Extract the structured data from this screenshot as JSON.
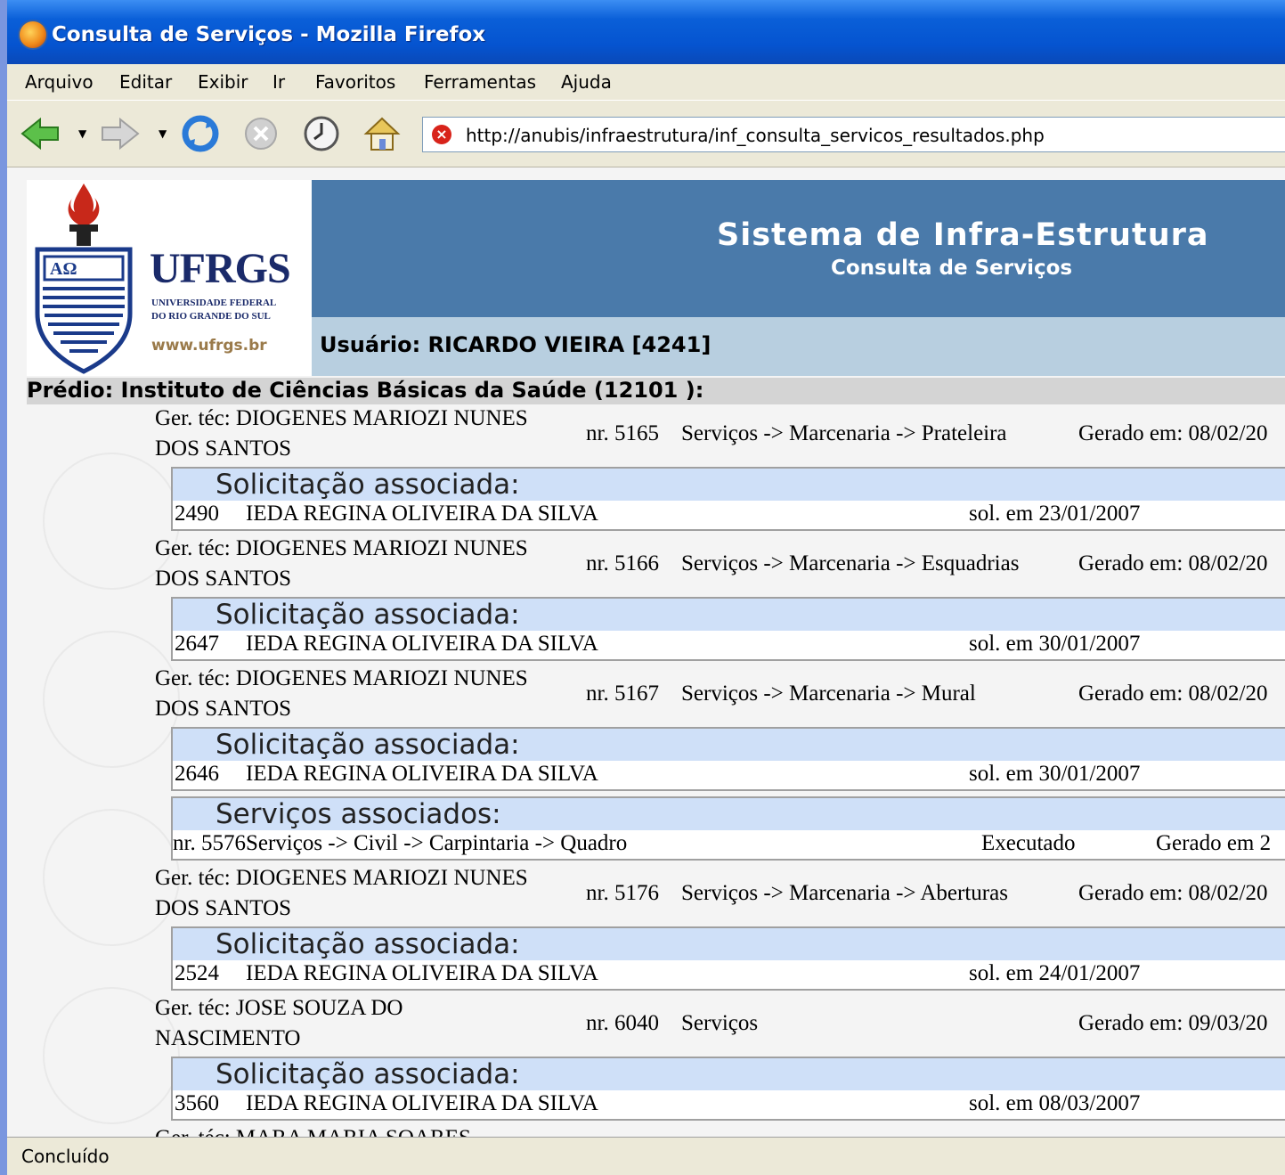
{
  "window": {
    "title": "Consulta de Serviços - Mozilla Firefox"
  },
  "menu": [
    "Arquivo",
    "Editar",
    "Exibir",
    "Ir",
    "Favoritos",
    "Ferramentas",
    "Ajuda"
  ],
  "toolbar": {
    "url": "http://anubis/infraestrutura/inf_consulta_servicos_resultados.php"
  },
  "logo": {
    "name": "UFRGS",
    "line1": "UNIVERSIDADE FEDERAL",
    "line2": "DO RIO GRANDE DO SUL",
    "site": "www.ufrgs.br"
  },
  "header": {
    "system": "Sistema de Infra-Estrutura",
    "subtitle": "Consulta de Serviços",
    "user": "Usuário: RICARDO VIEIRA [4241]"
  },
  "predio": "Prédio: Instituto de Ciências Básicas da Saúde (12101 ):",
  "labels": {
    "solicitacao": "Solicitação associada:",
    "servicos": "Serviços associados:"
  },
  "entries": [
    {
      "ger1": "Ger. téc: DIOGENES MARIOZI NUNES",
      "ger2": "DOS SANTOS",
      "nr": "nr. 5165",
      "path": "Serviços  -> Marcenaria  -> Prateleira",
      "gerado": "Gerado em: 08/02/20",
      "sol_num": "2490",
      "sol_nome": "IEDA REGINA OLIVEIRA DA SILVA",
      "sol_data": "sol. em 23/01/2007"
    },
    {
      "ger1": "Ger. téc: DIOGENES MARIOZI NUNES",
      "ger2": "DOS SANTOS",
      "nr": "nr. 5166",
      "path": "Serviços  -> Marcenaria  -> Esquadrias",
      "gerado": "Gerado em: 08/02/20",
      "sol_num": "2647",
      "sol_nome": "IEDA REGINA OLIVEIRA DA SILVA",
      "sol_data": "sol. em 30/01/2007"
    },
    {
      "ger1": "Ger. téc: DIOGENES MARIOZI NUNES",
      "ger2": "DOS SANTOS",
      "nr": "nr. 5167",
      "path": "Serviços  -> Marcenaria  -> Mural",
      "gerado": "Gerado em: 08/02/20",
      "sol_num": "2646",
      "sol_nome": "IEDA REGINA OLIVEIRA DA SILVA",
      "sol_data": "sol. em 30/01/2007",
      "serv_path": "nr. 5576Serviços  -> Civil  -> Carpintaria  -> Quadro",
      "serv_status": "Executado",
      "serv_gerado": "Gerado em 2"
    },
    {
      "ger1": "Ger. téc: DIOGENES MARIOZI NUNES",
      "ger2": "DOS SANTOS",
      "nr": "nr. 5176",
      "path": "Serviços  -> Marcenaria  -> Aberturas",
      "gerado": "Gerado em: 08/02/20",
      "sol_num": "2524",
      "sol_nome": "IEDA REGINA OLIVEIRA DA SILVA",
      "sol_data": "sol. em 24/01/2007"
    },
    {
      "ger1": "Ger. téc: JOSE SOUZA DO",
      "ger2": "NASCIMENTO",
      "nr": "nr. 6040",
      "path": "Serviços",
      "gerado": "Gerado em: 09/03/20",
      "sol_num": "3560",
      "sol_nome": "IEDA REGINA OLIVEIRA DA SILVA",
      "sol_data": "sol. em 08/03/2007"
    }
  ],
  "partial_next": "Ger. téc: MARA MARIA SOARES",
  "status": "Concluído"
}
